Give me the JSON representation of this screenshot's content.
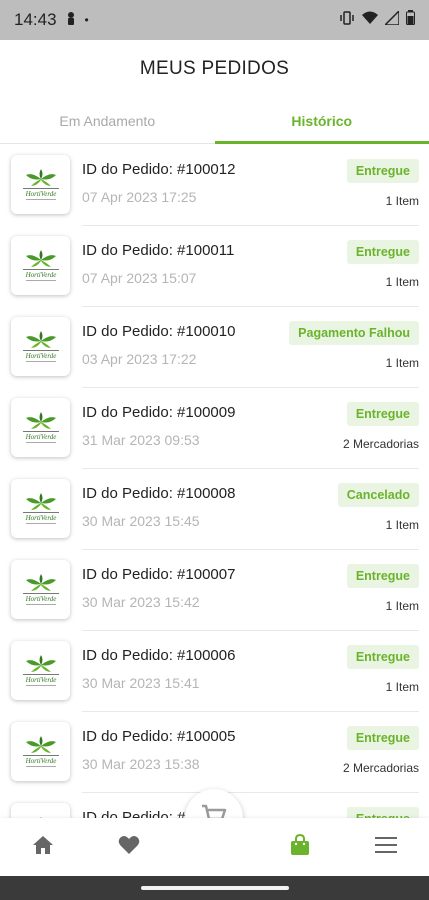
{
  "status_bar": {
    "time": "14:43",
    "dot": "•"
  },
  "header": {
    "title": "MEUS PEDIDOS"
  },
  "tabs": [
    {
      "label": "Em Andamento",
      "active": false
    },
    {
      "label": "Histórico",
      "active": true
    }
  ],
  "colors": {
    "accent": "#6ab42c",
    "badge_bg": "#eaf4e2",
    "muted_text": "#b5b5b5"
  },
  "orders": [
    {
      "id": "ID do Pedido:  #100012",
      "date": "07 Apr 2023  17:25",
      "status": "Entregue",
      "count": "1 Item"
    },
    {
      "id": "ID do Pedido:  #100011",
      "date": "07 Apr 2023  15:07",
      "status": "Entregue",
      "count": "1 Item"
    },
    {
      "id": "ID do Pedido:  #100010",
      "date": "03 Apr 2023  17:22",
      "status": "Pagamento Falhou",
      "count": "1 Item"
    },
    {
      "id": "ID do Pedido:  #100009",
      "date": "31 Mar 2023  09:53",
      "status": "Entregue",
      "count": "2 Mercadorias"
    },
    {
      "id": "ID do Pedido:  #100008",
      "date": "30 Mar 2023  15:45",
      "status": "Cancelado",
      "count": "1 Item"
    },
    {
      "id": "ID do Pedido:  #100007",
      "date": "30 Mar 2023  15:42",
      "status": "Entregue",
      "count": "1 Item"
    },
    {
      "id": "ID do Pedido:  #100006",
      "date": "30 Mar 2023  15:41",
      "status": "Entregue",
      "count": "1 Item"
    },
    {
      "id": "ID do Pedido:  #100005",
      "date": "30 Mar 2023  15:38",
      "status": "Entregue",
      "count": "2 Mercadorias"
    },
    {
      "id": "ID do Pedido:  #",
      "date": "",
      "status": "Entregue",
      "count": ""
    }
  ],
  "bottom_nav": [
    {
      "icon": "home-icon",
      "active": false
    },
    {
      "icon": "heart-icon",
      "active": false
    },
    {
      "icon": "cart-icon",
      "active": false
    },
    {
      "icon": "shopping-bag-icon",
      "active": true
    },
    {
      "icon": "menu-icon",
      "active": false
    }
  ]
}
